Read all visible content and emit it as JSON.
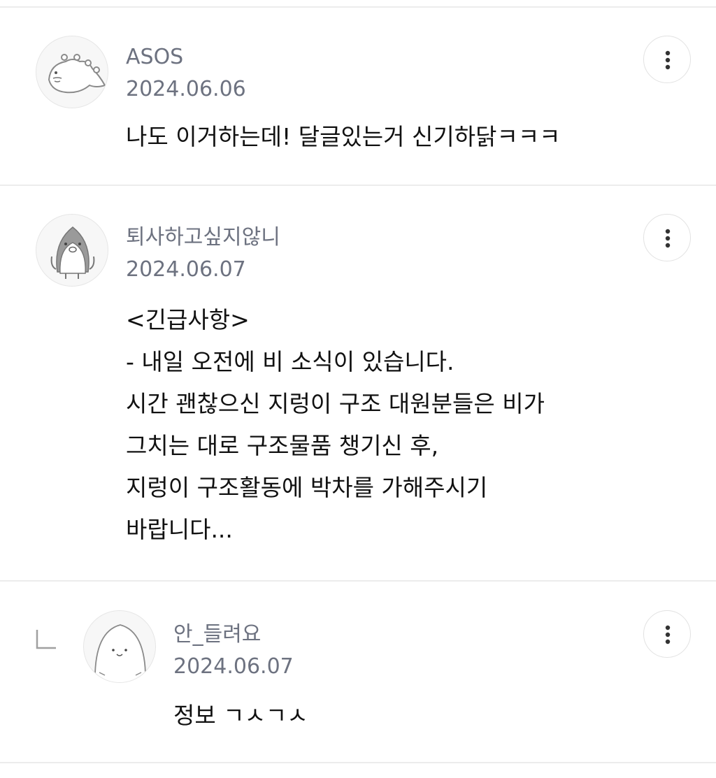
{
  "comments": [
    {
      "author": "ASOS",
      "date": "2024.06.06",
      "body": "나도 이거하는데! 달글있는거 신기하닭ㅋㅋㅋ",
      "avatar_icon": "dinosaur-avatar-icon",
      "is_reply": false
    },
    {
      "author": "퇴사하고싶지않니",
      "date": "2024.06.07",
      "body": "<긴급사항>\n- 내일 오전에 비 소식이 있습니다.\n시간 괜찮으신 지렁이 구조 대원분들은 비가\n그치는 대로 구조물품 챙기신 후,\n지렁이 구조활동에 박차를 가해주시기\n바랍니다...",
      "avatar_icon": "penguin-avatar-icon",
      "is_reply": false
    },
    {
      "author": "안_들려요",
      "date": "2024.06.07",
      "body": "정보 ㄱㅅㄱㅅ",
      "avatar_icon": "round-character-avatar-icon",
      "is_reply": true
    }
  ],
  "icons": {
    "more": "more-vertical-icon",
    "reply": "reply-arrow-icon"
  },
  "colors": {
    "meta_text": "#6d7280",
    "body_text": "#111111",
    "divider": "#ececec"
  }
}
